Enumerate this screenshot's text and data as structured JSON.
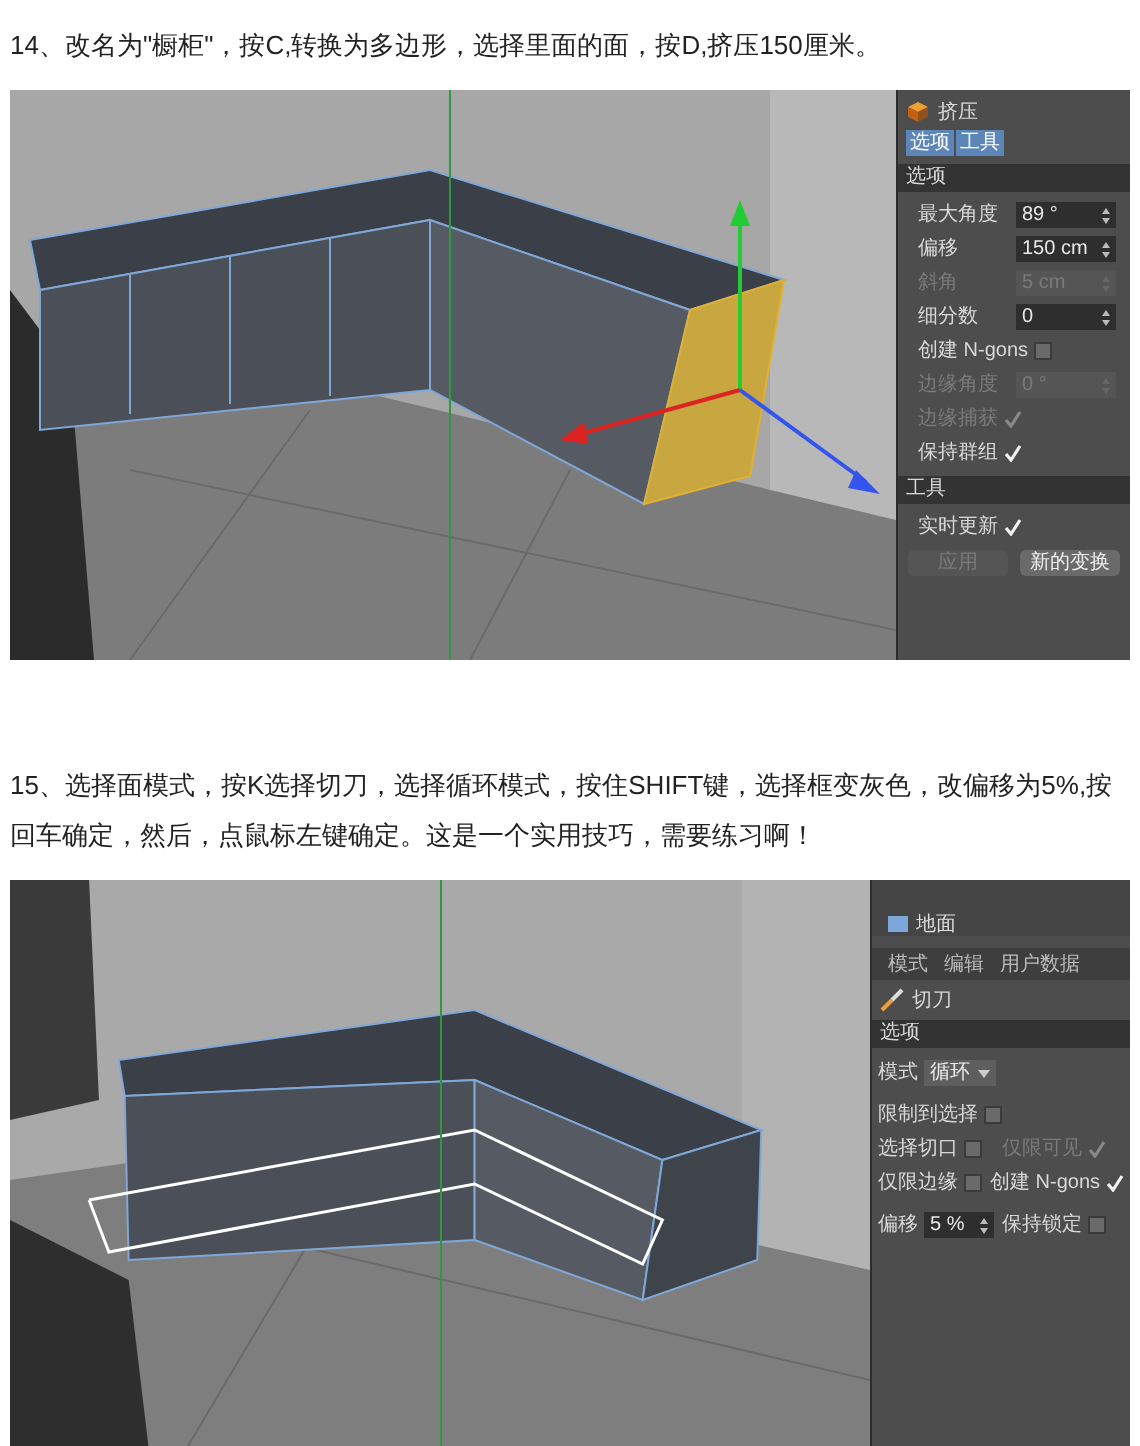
{
  "step_14": {
    "text": "14、改名为\"橱柜\"，按C,转换为多边形，选择里面的面，按D,挤压150厘米。"
  },
  "figure_1": {
    "panel": {
      "title": "挤压",
      "tabs": [
        {
          "label": "选项",
          "selected": true
        },
        {
          "label": "工具",
          "selected": true
        }
      ],
      "sections": [
        {
          "title": "选项",
          "rows": [
            {
              "kind": "field",
              "label": "最大角度",
              "value": "89 °",
              "disabled": false
            },
            {
              "kind": "field",
              "label": "偏移",
              "value": "150 cm",
              "disabled": false
            },
            {
              "kind": "field",
              "label": "斜角",
              "value": "5 cm",
              "disabled": true
            },
            {
              "kind": "field",
              "label": "细分数",
              "value": "0",
              "disabled": false
            },
            {
              "kind": "checkbox",
              "label": "创建 N-gons",
              "checked": false,
              "disabled": false
            },
            {
              "kind": "field",
              "label": "边缘角度",
              "value": "0 °",
              "disabled": true
            },
            {
              "kind": "checkbox",
              "label": "边缘捕获",
              "checked": true,
              "disabled": true
            },
            {
              "kind": "checkbox",
              "label": "保持群组",
              "checked": true,
              "disabled": false
            }
          ]
        },
        {
          "title": "工具",
          "rows": [
            {
              "kind": "checkbox",
              "label": "实时更新",
              "checked": true,
              "disabled": false
            }
          ],
          "buttons": [
            {
              "label": "应用",
              "disabled": true
            },
            {
              "label": "新的变换",
              "disabled": false
            }
          ]
        }
      ]
    }
  },
  "step_15": {
    "text": "15、选择面模式，按K选择切刀，选择循环模式，按住SHIFT键，选择框变灰色，改偏移为5%,按回车确定，然后，点鼠标左键确定。这是一个实用技巧，需要练习啊！"
  },
  "figure_2": {
    "panel": {
      "object_list": [
        {
          "label": "地面"
        }
      ],
      "tabs": [
        {
          "label": "模式"
        },
        {
          "label": "编辑"
        },
        {
          "label": "用户数据"
        }
      ],
      "title": "切刀",
      "section": "选项",
      "rows": [
        [
          {
            "kind": "dropdown",
            "label": "模式",
            "value": "循环"
          }
        ],
        [
          {
            "kind": "checkbox",
            "label": "限制到选择",
            "checked": false,
            "disabled": false
          }
        ],
        [
          {
            "kind": "checkbox",
            "label": "选择切口",
            "checked": false,
            "disabled": false
          },
          {
            "kind": "checkbox",
            "label": "仅限可见",
            "checked": true,
            "disabled": true
          }
        ],
        [
          {
            "kind": "checkbox",
            "label": "仅限边缘",
            "checked": false,
            "disabled": false
          },
          {
            "kind": "checkbox",
            "label": "创建 N-gons",
            "checked": true,
            "disabled": false
          }
        ],
        [
          {
            "kind": "field",
            "label": "偏移",
            "value": "5 %",
            "disabled": false
          },
          {
            "kind": "checkbox",
            "label": "保持锁定",
            "checked": false,
            "disabled": false
          }
        ]
      ]
    }
  }
}
